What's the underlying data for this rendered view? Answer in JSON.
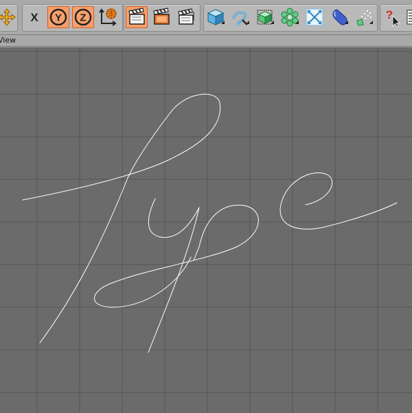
{
  "toolbar": {
    "groups": [
      "transform",
      "axis-lock",
      "render",
      "create",
      "help"
    ],
    "buttons": [
      {
        "id": "move-tool",
        "icon": "move-arrows-icon"
      },
      {
        "id": "x-axis",
        "label": "X",
        "icon": "x-axis-icon"
      },
      {
        "id": "y-axis",
        "label": "Y",
        "icon": "y-axis-icon"
      },
      {
        "id": "z-axis",
        "label": "Z",
        "icon": "z-axis-icon"
      },
      {
        "id": "coordinate-system",
        "icon": "world-coordinates-icon"
      },
      {
        "id": "render-view",
        "icon": "clapperboard-icon"
      },
      {
        "id": "render-picture-viewer",
        "icon": "clapperboard-orange-icon"
      },
      {
        "id": "render-settings",
        "icon": "clapperboard-stack-icon"
      },
      {
        "id": "cube",
        "icon": "cube-icon"
      },
      {
        "id": "spline",
        "icon": "spline-pen-icon"
      },
      {
        "id": "subdivision",
        "icon": "subdivision-cube-icon"
      },
      {
        "id": "array",
        "icon": "cloner-icon"
      },
      {
        "id": "deformer",
        "icon": "deformer-arrows-icon"
      },
      {
        "id": "scene-object",
        "icon": "capsule-icon"
      },
      {
        "id": "particle",
        "icon": "particles-icon"
      },
      {
        "id": "help",
        "icon": "help-pointer-icon"
      },
      {
        "id": "more",
        "icon": "list-icon"
      }
    ]
  },
  "menu": {
    "view_label": "View"
  },
  "viewport": {
    "background": "#6b6b6b",
    "grid_color": "#555555",
    "spline_color": "#ffffff",
    "drawn_text": "Type"
  }
}
